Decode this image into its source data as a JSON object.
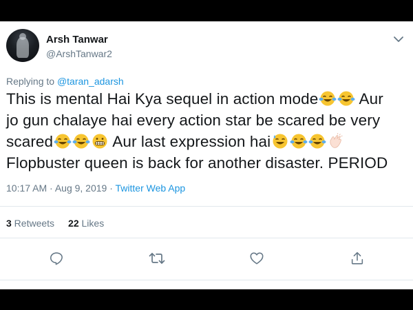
{
  "tweet": {
    "author_name": "Arsh Tanwar",
    "author_handle": "@ArshTanwar2",
    "replying_prefix": "Replying to ",
    "replying_to": "@taran_adarsh",
    "text_lines": [
      "This is mental Hai Kya sequel in action mode",
      " Aur",
      "jo gun chalaye hai every action star be scared be very",
      "scared",
      " Aur last expression hai",
      "Flopbuster queen is back for another disaster. PERIOD"
    ],
    "timestamp": "10:17 AM · Aug 9, 2019 · ",
    "source": "Twitter Web App",
    "retweets_count": "3",
    "retweets_label": " Retweets",
    "likes_count": "22",
    "likes_label": " Likes"
  },
  "icons": {
    "more": "chevron-down-icon",
    "reply": "reply-icon",
    "retweet": "retweet-icon",
    "like": "heart-icon",
    "share": "share-icon",
    "emoji_laugh": "face-with-tears-of-joy-emoji",
    "emoji_grimace": "grimacing-face-emoji",
    "emoji_sweat": "grinning-face-with-sweat-emoji",
    "emoji_clap": "clapping-hands-emoji"
  },
  "colors": {
    "link": "#1b95e0",
    "secondary_text": "#657786",
    "primary_text": "#14171a",
    "divider": "#e1e8ed"
  }
}
